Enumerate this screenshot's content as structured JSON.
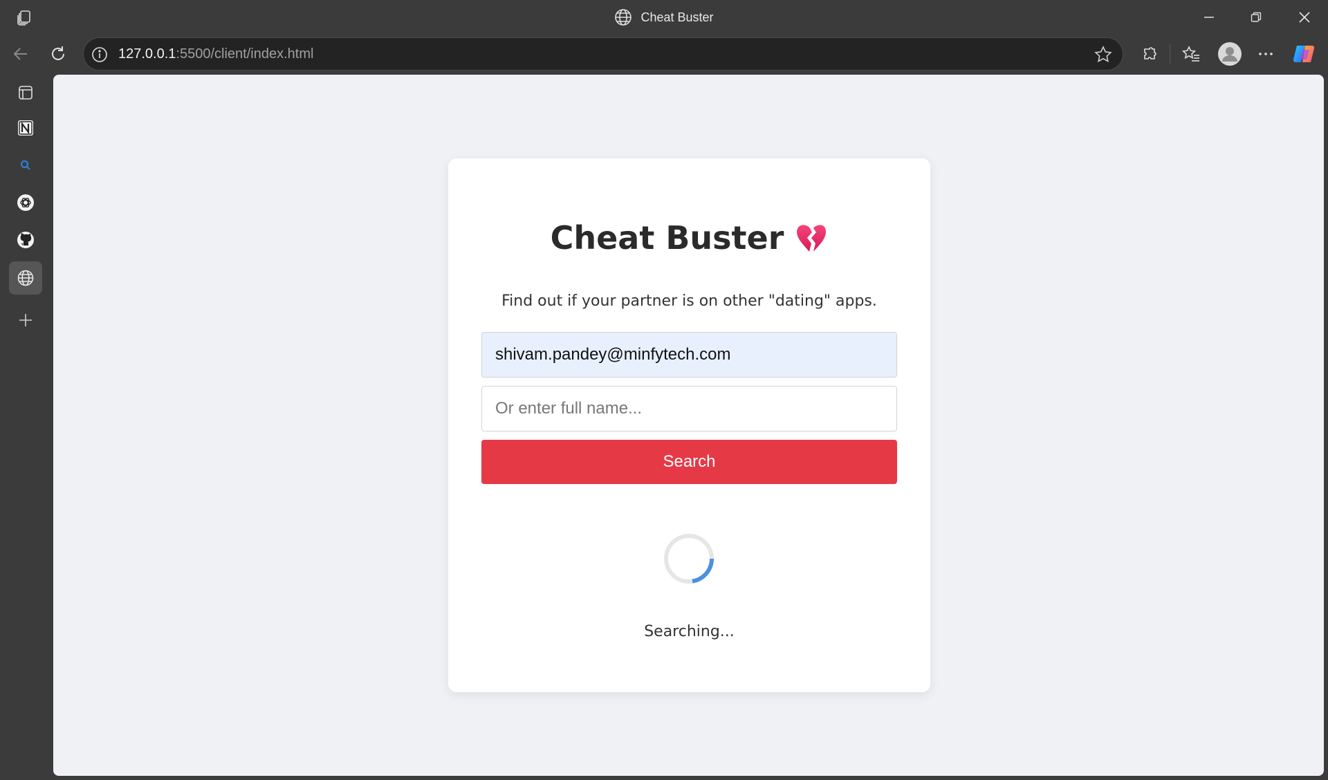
{
  "window": {
    "title": "Cheat Buster"
  },
  "toolbar": {
    "url_host": "127.0.0.1",
    "url_rest": ":5500/client/index.html"
  },
  "sidebar": {
    "items": [
      {
        "icon": "tab-actions-icon"
      },
      {
        "icon": "notion-icon"
      },
      {
        "icon": "search-icon"
      },
      {
        "icon": "chatgpt-icon"
      },
      {
        "icon": "github-icon"
      },
      {
        "icon": "globe-icon",
        "active": true
      },
      {
        "icon": "add-icon"
      }
    ]
  },
  "page": {
    "title": "Cheat Buster",
    "title_emoji": "broken-heart-icon",
    "subtitle": "Find out if your partner is on other \"dating\" apps.",
    "email_value": "shivam.pandey@minfytech.com",
    "name_placeholder": "Or enter full name...",
    "search_label": "Search",
    "status_text": "Searching...",
    "accent_color": "#e63946",
    "spinner_color": "#4a90e2"
  }
}
